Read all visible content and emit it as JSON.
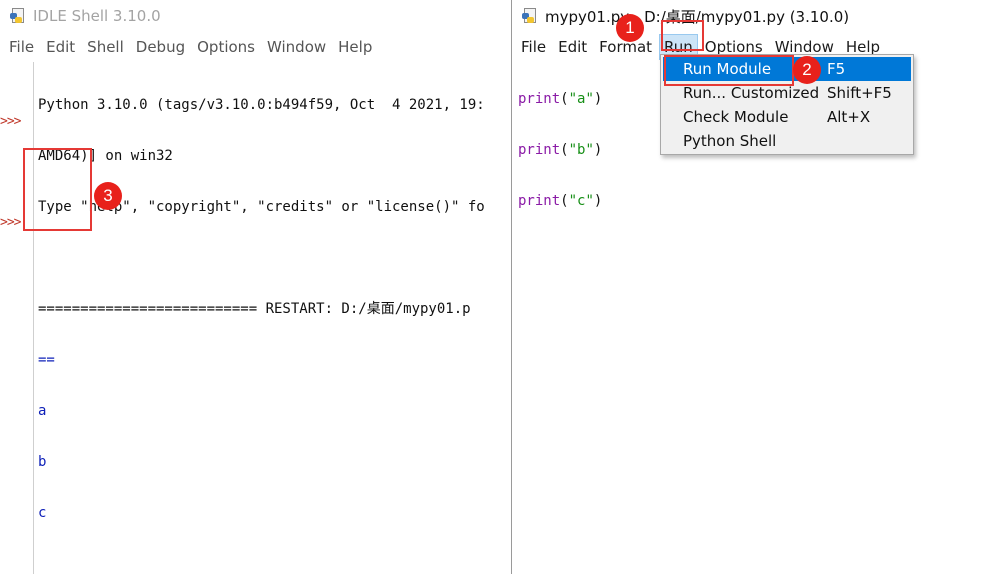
{
  "shell": {
    "title": "IDLE Shell 3.10.0",
    "menu": [
      "File",
      "Edit",
      "Shell",
      "Debug",
      "Options",
      "Window",
      "Help"
    ],
    "lines": [
      "Python 3.10.0 (tags/v3.10.0:b494f59, Oct  4 2021, 19:",
      "AMD64)] on win32",
      "Type \"help\", \"copyright\", \"credits\" or \"license()\" fo",
      "",
      "========================== RESTART: D:/桌面/mypy01.p"
    ],
    "output": [
      "==",
      "a",
      "b",
      "c"
    ],
    "prompt": ">>>"
  },
  "editor": {
    "title": "mypy01.py - D:/桌面/mypy01.py (3.10.0)",
    "menu": [
      "File",
      "Edit",
      "Format",
      "Run",
      "Options",
      "Window",
      "Help"
    ],
    "active_menu": "Run",
    "code": [
      {
        "fn": "print",
        "open": "(",
        "arg": "\"a\"",
        "close": ")"
      },
      {
        "fn": "print",
        "open": "(",
        "arg": "\"b\"",
        "close": ")"
      },
      {
        "fn": "print",
        "open": "(",
        "arg": "\"c\"",
        "close": ")"
      }
    ]
  },
  "run_menu": {
    "items": [
      {
        "label": "Run Module",
        "shortcut": "F5",
        "selected": true
      },
      {
        "label": "Run... Customized",
        "shortcut": "Shift+F5",
        "selected": false
      },
      {
        "label": "Check Module",
        "shortcut": "Alt+X",
        "selected": false
      },
      {
        "label": "Python Shell",
        "shortcut": "",
        "selected": false
      }
    ]
  },
  "annotations": {
    "badges": [
      "1",
      "2",
      "3"
    ],
    "color": "#e8211b"
  },
  "colors": {
    "keyword": "#8a1aa6",
    "string": "#178f17",
    "output": "#0d1fb8",
    "prompt": "#c0392b",
    "selection": "#0078d7"
  }
}
